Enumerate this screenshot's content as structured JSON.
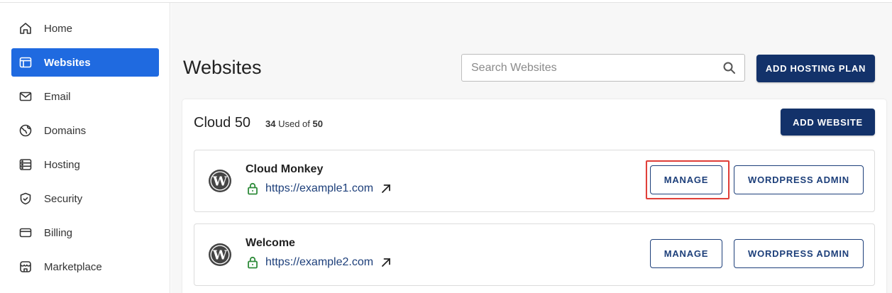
{
  "sidebar": {
    "items": [
      {
        "label": "Home",
        "icon": "home-icon"
      },
      {
        "label": "Websites",
        "icon": "browser-window-icon",
        "active": true
      },
      {
        "label": "Email",
        "icon": "envelope-icon"
      },
      {
        "label": "Domains",
        "icon": "globe-icon"
      },
      {
        "label": "Hosting",
        "icon": "server-icon"
      },
      {
        "label": "Security",
        "icon": "shield-icon"
      },
      {
        "label": "Billing",
        "icon": "credit-card-icon"
      },
      {
        "label": "Marketplace",
        "icon": "storefront-icon"
      }
    ]
  },
  "header": {
    "title": "Websites",
    "search_placeholder": "Search Websites",
    "search_value": "",
    "add_hosting_plan_label": "ADD HOSTING PLAN"
  },
  "plan": {
    "name": "Cloud 50",
    "used": "34",
    "used_text": "Used of",
    "total": "50",
    "add_website_label": "ADD WEBSITE"
  },
  "sites": [
    {
      "name": "Cloud Monkey",
      "url": "https://example1.com",
      "manage_label": "MANAGE",
      "wp_admin_label": "WORDPRESS ADMIN",
      "highlighted": true
    },
    {
      "name": "Welcome",
      "url": "https://example2.com",
      "manage_label": "MANAGE",
      "wp_admin_label": "WORDPRESS ADMIN"
    }
  ],
  "colors": {
    "accent": "#1f6ae0",
    "primary_button": "#13326a",
    "link": "#1d3f7a",
    "lock": "#2e8b3a",
    "highlight": "#e0403a"
  }
}
